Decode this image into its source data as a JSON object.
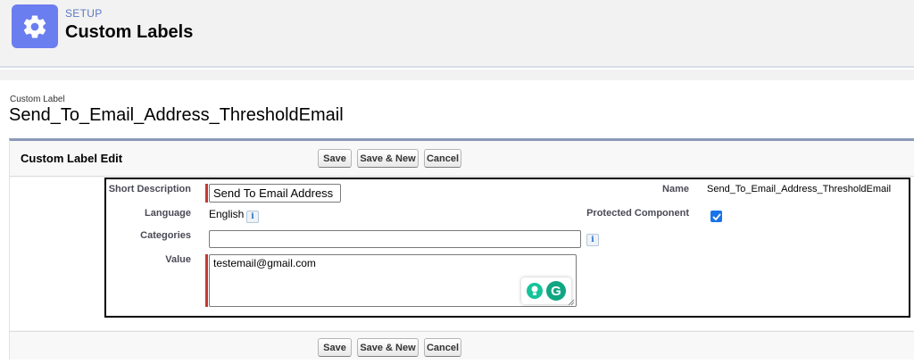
{
  "header": {
    "eyebrow": "SETUP",
    "title": "Custom Labels",
    "icon": "gear-icon"
  },
  "record": {
    "eyebrow": "Custom Label",
    "title": "Send_To_Email_Address_ThresholdEmail"
  },
  "edit_block": {
    "title": "Custom Label Edit",
    "buttons": {
      "save": "Save",
      "save_new": "Save & New",
      "cancel": "Cancel"
    }
  },
  "form": {
    "short_description": {
      "label": "Short Description",
      "value": "Send To Email Address",
      "required": true
    },
    "language": {
      "label": "Language",
      "value": "English"
    },
    "categories": {
      "label": "Categories",
      "value": ""
    },
    "value": {
      "label": "Value",
      "text": "testemail@gmail.com",
      "required": true
    },
    "name": {
      "label": "Name",
      "value": "Send_To_Email_Address_ThresholdEmail"
    },
    "protected_component": {
      "label": "Protected Component",
      "checked": true
    }
  },
  "info_glyph": "i",
  "grammarly_letter": "G",
  "colors": {
    "setup_icon_bg": "#6b7ef0",
    "required": "#c23934",
    "checkbox": "#1a73e8",
    "grammarly": "#15c39a"
  }
}
